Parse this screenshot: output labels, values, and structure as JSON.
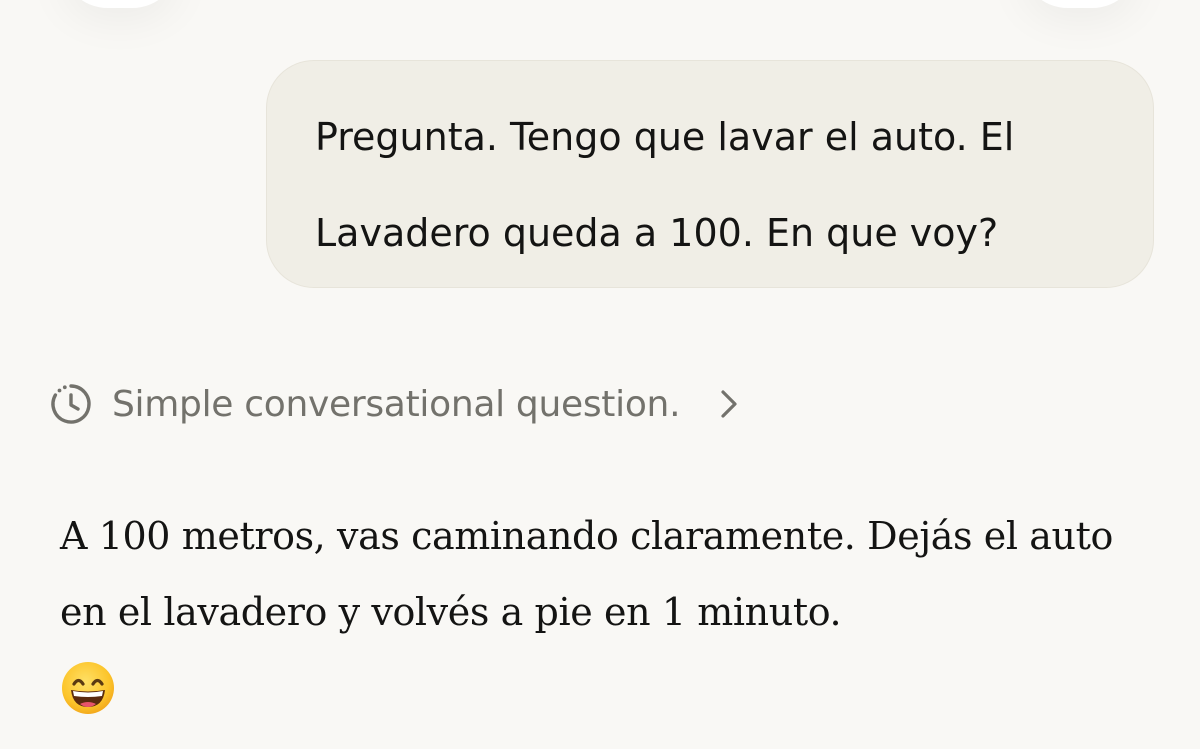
{
  "conversation": {
    "user_message": "Pregunta. Tengo que lavar el auto. El\nLavadero queda a 100. En que voy?",
    "thinking_summary": "Simple conversational question.",
    "assistant_reply": "A 100 metros, vas caminando claramente. Dejás el auto en el lavadero y volvés a pie en 1 minuto."
  },
  "icons": {
    "thinking": "clock-icon",
    "expand": "chevron-right-icon",
    "emoji": "grinning-face-emoji"
  },
  "colors": {
    "background": "#f9f8f5",
    "user_bubble": "#f0eee6",
    "text": "#141413",
    "muted_text": "#73726c"
  }
}
